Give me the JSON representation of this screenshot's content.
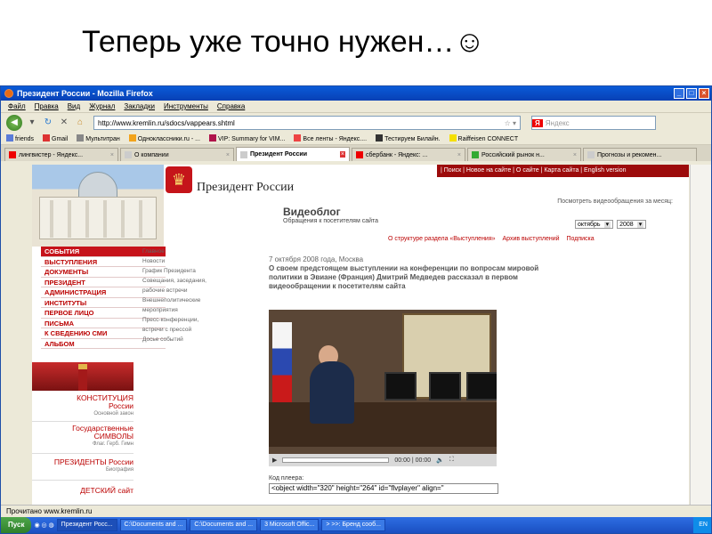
{
  "slide": {
    "title": "Теперь уже точно нужен…☺"
  },
  "browser": {
    "window_title": "Президент России - Mozilla Firefox",
    "menu": [
      "Файл",
      "Правка",
      "Вид",
      "Журнал",
      "Закладки",
      "Инструменты",
      "Справка"
    ],
    "url": "http://www.kremlin.ru/sdocs/vappears.shtml",
    "search_placeholder": "Яндекс",
    "search_brand": "Я",
    "bookmarks": [
      "friends",
      "Gmail",
      "Мультитран",
      "Одноклассники.ru - ...",
      "VIP: Summary for VIM...",
      "Все ленты - Яндекс....",
      "Тестируем Билайн.",
      "Raiffeisen CONNECT"
    ],
    "tabs": [
      {
        "label": "лингвистер - Яндекс...",
        "active": false
      },
      {
        "label": "О компании",
        "active": false
      },
      {
        "label": "Президент России",
        "active": true
      },
      {
        "label": "сбербанк - Яндекс: ...",
        "active": false
      },
      {
        "label": "Российский рынок н...",
        "active": false
      },
      {
        "label": "Прогнозы и рекомен...",
        "active": false
      }
    ],
    "status": "Прочитано www.kremlin.ru"
  },
  "page": {
    "topbar": "| Поиск | Новое на сайте | О сайте | Карта сайта | English version",
    "site_title": "Президент России",
    "videoblog_title": "Видеоблог",
    "videoblog_subtitle": "Обращения к посетителям сайта",
    "watch_text": "Посмотреть видеообращения за месяц:",
    "month": "октябрь",
    "year": "2008",
    "subnav": [
      "О структуре раздела «Выступления»",
      "Архив выступлений",
      "Подписка"
    ],
    "menu": [
      "СОБЫТИЯ",
      "ВЫСТУПЛЕНИЯ",
      "ДОКУМЕНТЫ",
      "ПРЕЗИДЕНТ",
      "АДМИНИСТРАЦИЯ",
      "ИНСТИТУТЫ",
      "ПЕРВОЕ ЛИЦО",
      "ПИСЬМА",
      "К СВЕДЕНИЮ СМИ",
      "АЛЬБОМ"
    ],
    "submenu": [
      "Главное",
      "Новости",
      "График Президента",
      "Совещания, заседания,",
      "рабочие встречи",
      "Внешнеполитические",
      "мероприятия",
      "Пресс-конференции,",
      "встречи с прессой",
      "Досье событий"
    ],
    "date": "7 октября 2008 года, Москва",
    "headline": "О своем предстоящем выступлении на конференции по вопросам мировой политики в Эвиане (Франция) Дмитрий Медведев рассказал в первом видеообращении к посетителям сайта",
    "player_time": "00:00 | 00:00",
    "code_label": "Код плеера:",
    "code_value": "<object width=\"320\" height=\"264\" id=\"flvplayer\" align=\"",
    "blocks": [
      {
        "title1": "КОНСТИТУЦИЯ",
        "title2": "России",
        "sub": "Основной закон"
      },
      {
        "title1": "Государственные",
        "title2": "СИМВОЛЫ",
        "sub": "Флаг. Герб. Гимн"
      },
      {
        "title1": "ПРЕЗИДЕНТЫ России",
        "title2": "",
        "sub": "Биография"
      },
      {
        "title1": "ДЕТСКИЙ сайт",
        "title2": "",
        "sub": ""
      }
    ]
  },
  "taskbar": {
    "start": "Пуск",
    "tasks": [
      "Президент Росс...",
      "C:\\Documents and ...",
      "C:\\Documents and ...",
      "3 Microsoft Offic...",
      "> >>: Бренд сооб..."
    ],
    "lang": "EN"
  },
  "colors": {
    "kremlin_red": "#c6121a",
    "xp_blue": "#0a5bd8"
  }
}
